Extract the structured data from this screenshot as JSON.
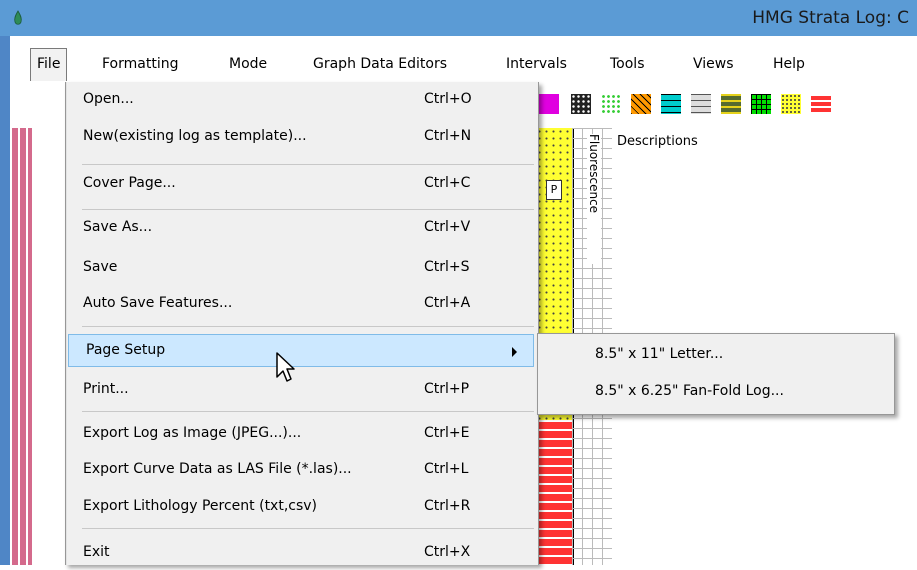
{
  "window": {
    "title": "HMG Strata Log: C"
  },
  "menubar": {
    "items": [
      {
        "label": "File"
      },
      {
        "label": "Formatting"
      },
      {
        "label": "Mode"
      },
      {
        "label": "Graph Data Editors"
      },
      {
        "label": "Intervals"
      },
      {
        "label": "Tools"
      },
      {
        "label": "Views"
      },
      {
        "label": "Help"
      }
    ]
  },
  "log": {
    "fluorescence_label": "Fluorescence",
    "descriptions_label": "Descriptions",
    "p_marker": "P"
  },
  "file_menu": {
    "items": [
      {
        "label": "Open...",
        "shortcut": "Ctrl+O"
      },
      {
        "label": "New(existing log as template)...",
        "shortcut": "Ctrl+N"
      },
      {
        "label": "Cover Page...",
        "shortcut": "Ctrl+C"
      },
      {
        "label": "Save As...",
        "shortcut": "Ctrl+V"
      },
      {
        "label": "Save",
        "shortcut": "Ctrl+S"
      },
      {
        "label": "Auto Save Features...",
        "shortcut": "Ctrl+A"
      },
      {
        "label": "Page Setup",
        "shortcut": ""
      },
      {
        "label": "Print...",
        "shortcut": "Ctrl+P"
      },
      {
        "label": "Export Log as Image (JPEG...)...",
        "shortcut": "Ctrl+E"
      },
      {
        "label": "Export Curve Data as LAS File (*.las)...",
        "shortcut": "Ctrl+L"
      },
      {
        "label": "Export Lithology Percent (txt,csv)",
        "shortcut": "Ctrl+R"
      },
      {
        "label": "Exit",
        "shortcut": "Ctrl+X"
      }
    ]
  },
  "page_setup_submenu": {
    "items": [
      {
        "label": "8.5\" x 11\" Letter..."
      },
      {
        "label": "8.5\" x 6.25\" Fan-Fold Log..."
      }
    ]
  },
  "colors": {
    "titlebar": "#5b9bd5",
    "menu_bg": "#f0f0f0",
    "highlight": "#cce8ff"
  }
}
